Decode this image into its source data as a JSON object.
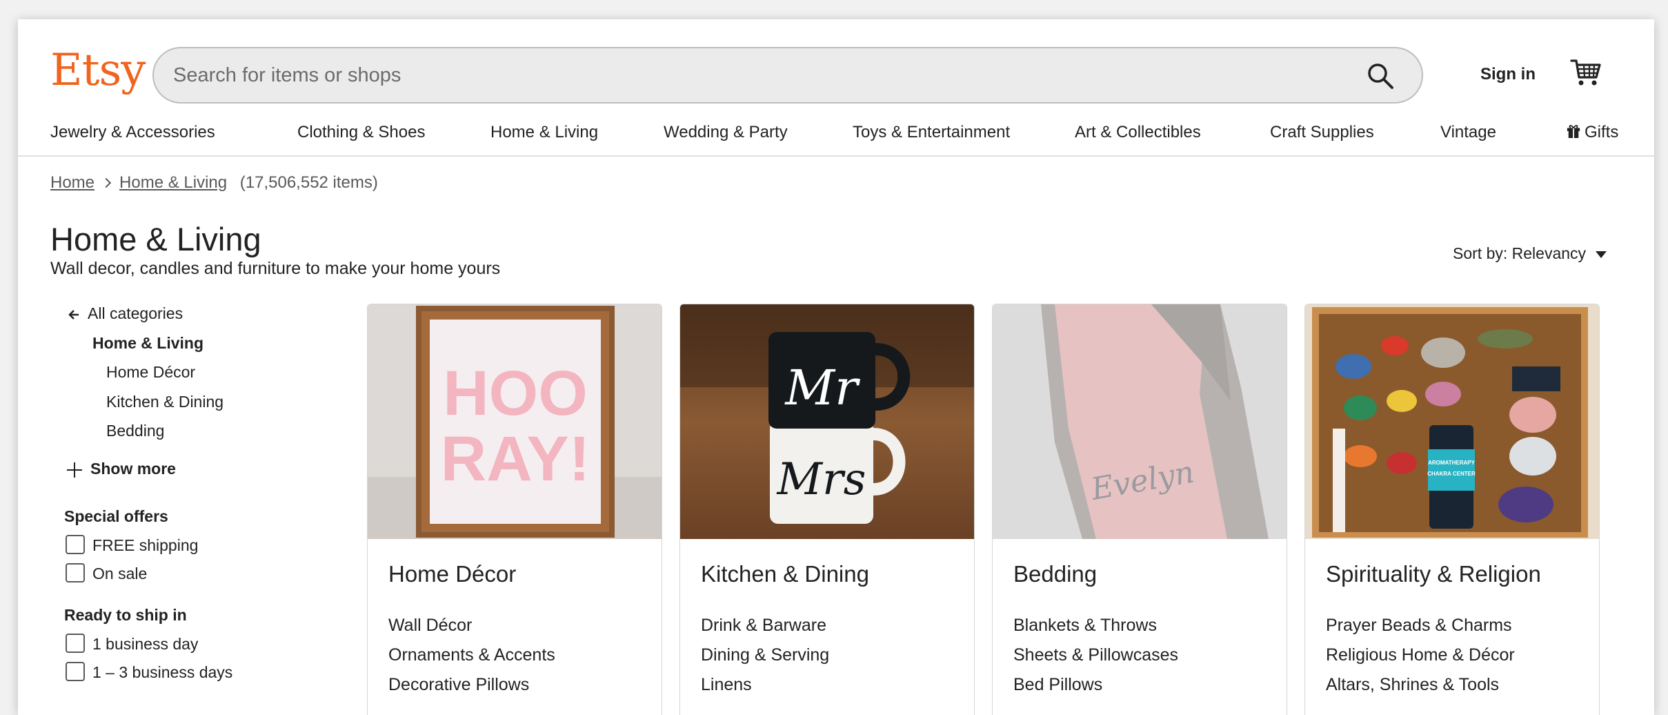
{
  "header": {
    "logo": "Etsy",
    "search_placeholder": "Search for items or shops",
    "sign_in": "Sign in"
  },
  "nav": [
    "Jewelry & Accessories",
    "Clothing & Shoes",
    "Home & Living",
    "Wedding & Party",
    "Toys & Entertainment",
    "Art & Collectibles",
    "Craft Supplies",
    "Vintage",
    "Gifts"
  ],
  "breadcrumb": {
    "home": "Home",
    "current": "Home & Living",
    "count": "(17,506,552 items)"
  },
  "page": {
    "title": "Home & Living",
    "subtitle": "Wall decor, candles and furniture to make your home yours",
    "sort_label": "Sort by: Relevancy"
  },
  "sidebar": {
    "all_categories": "All categories",
    "current": "Home & Living",
    "subcategories": [
      "Home Décor",
      "Kitchen & Dining",
      "Bedding"
    ],
    "show_more": "Show more",
    "special_offers": {
      "title": "Special offers",
      "options": [
        "FREE shipping",
        "On sale"
      ]
    },
    "ready_to_ship": {
      "title": "Ready to ship in",
      "options": [
        "1 business day",
        "1 – 3 business days"
      ]
    }
  },
  "cards": [
    {
      "title": "Home Décor",
      "links": [
        "Wall Décor",
        "Ornaments & Accents",
        "Decorative Pillows"
      ],
      "image_text": [
        "HOO",
        "RAY!"
      ]
    },
    {
      "title": "Kitchen & Dining",
      "links": [
        "Drink & Barware",
        "Dining & Serving",
        "Linens"
      ],
      "image_text": [
        "Mr",
        "Mrs"
      ]
    },
    {
      "title": "Bedding",
      "links": [
        "Blankets & Throws",
        "Sheets & Pillowcases",
        "Bed Pillows"
      ],
      "image_text": [
        "Evelyn"
      ]
    },
    {
      "title": "Spirituality & Religion",
      "links": [
        "Prayer Beads & Charms",
        "Religious Home & Décor",
        "Altars, Shrines & Tools"
      ],
      "image_text": [
        "AROMATHERAPY",
        "CHAKRA CENTER"
      ]
    }
  ],
  "colors": {
    "brand": "#f1641e",
    "text": "#222222",
    "muted": "#595959"
  }
}
